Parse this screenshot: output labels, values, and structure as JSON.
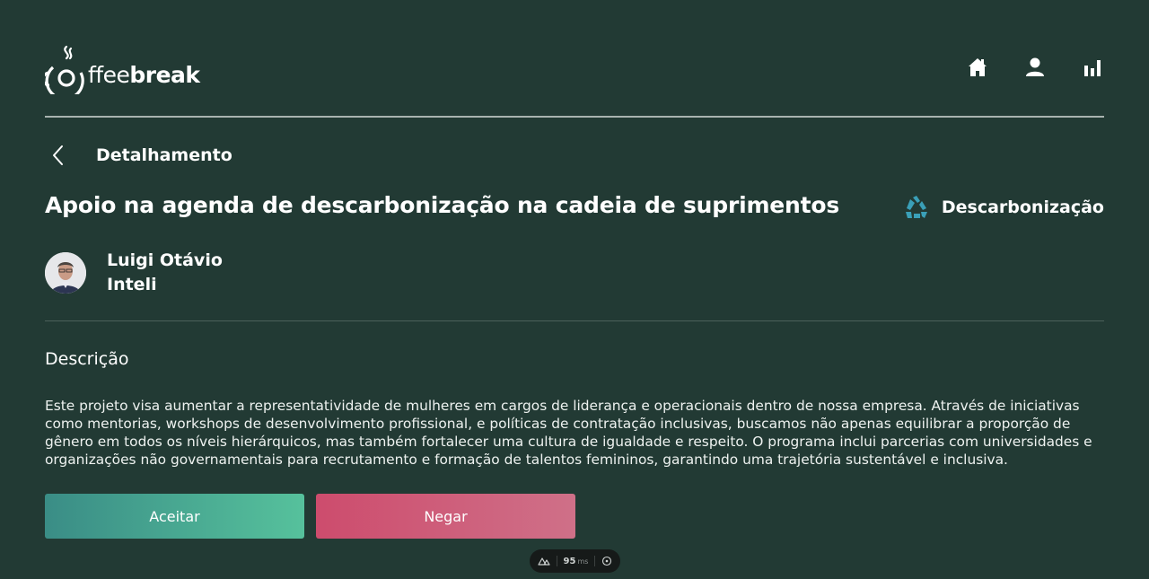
{
  "header": {
    "logo_light": "ffee",
    "logo_bold": "break",
    "nav": [
      {
        "name": "home-icon"
      },
      {
        "name": "user-icon"
      },
      {
        "name": "chart-icon"
      }
    ]
  },
  "detail": {
    "title": "Detalhamento"
  },
  "project": {
    "title": "Apoio na agenda de descarbonização na cadeia de suprimentos",
    "category": "Descarbonização",
    "category_icon": "recycle-icon",
    "category_color": "#3aa0b8"
  },
  "author": {
    "name": "Luigi Otávio",
    "org": "Inteli"
  },
  "description": {
    "heading": "Descrição",
    "text": "Este projeto visa aumentar a representatividade de mulheres em cargos de liderança e operacionais dentro de nossa empresa. Através de iniciativas como mentorias, workshops de desenvolvimento profissional, e políticas de contratação inclusivas, buscamos não apenas equilibrar a proporção de gênero em todos os níveis hierárquicos, mas também fortalecer uma cultura de igualdade e respeito. O programa inclui parcerias com universidades e organizações não governamentais para recrutamento e formação de talentos femininos, garantindo uma trajetória sustentável e inclusiva."
  },
  "actions": {
    "accept_label": "Aceitar",
    "deny_label": "Negar"
  },
  "devbar": {
    "ms_value": "95",
    "ms_unit": "ms"
  }
}
